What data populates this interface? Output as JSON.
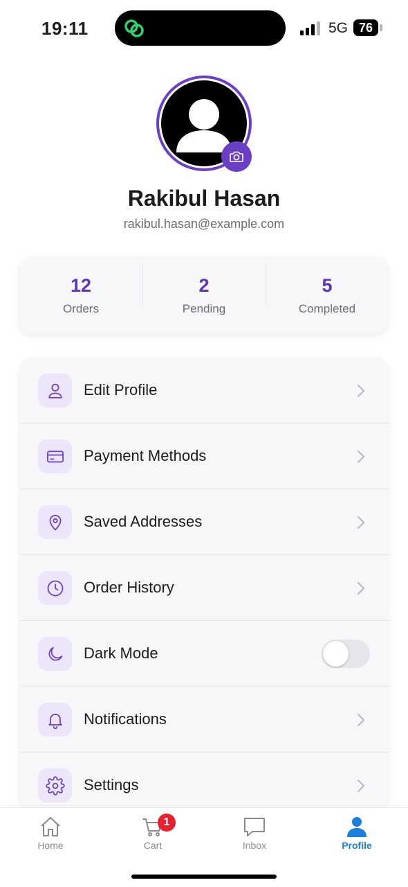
{
  "status_bar": {
    "time": "19:11",
    "network": "5G",
    "battery": "76"
  },
  "profile": {
    "name": "Rakibul Hasan",
    "email": "rakibul.hasan@example.com"
  },
  "stats": [
    {
      "value": "12",
      "label": "Orders"
    },
    {
      "value": "2",
      "label": "Pending"
    },
    {
      "value": "5",
      "label": "Completed"
    }
  ],
  "menu": {
    "items": [
      {
        "label": "Edit Profile",
        "icon": "user-icon"
      },
      {
        "label": "Payment Methods",
        "icon": "credit-card-icon"
      },
      {
        "label": "Saved Addresses",
        "icon": "map-pin-icon"
      },
      {
        "label": "Order History",
        "icon": "clock-icon"
      },
      {
        "label": "Dark Mode",
        "icon": "moon-icon",
        "toggle": false
      },
      {
        "label": "Notifications",
        "icon": "bell-icon"
      },
      {
        "label": "Settings",
        "icon": "gear-icon"
      }
    ]
  },
  "tabs": [
    {
      "label": "Home",
      "icon": "home-icon"
    },
    {
      "label": "Cart",
      "icon": "cart-icon",
      "badge": "1"
    },
    {
      "label": "Inbox",
      "icon": "chat-icon"
    },
    {
      "label": "Profile",
      "icon": "profile-icon",
      "active": true
    }
  ],
  "colors": {
    "accent": "#6a3fc6",
    "stat_value": "#5b35b8",
    "active_tab": "#1a7fe0",
    "badge": "#e8212e",
    "icon_bg": "#ede6fb"
  }
}
